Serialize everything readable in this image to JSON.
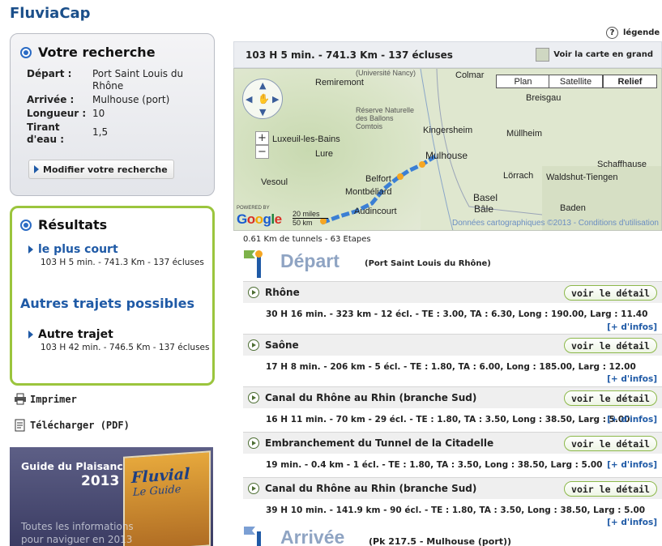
{
  "brand": "FluviaCap",
  "search": {
    "title": "Votre recherche",
    "rows": [
      {
        "label": "Départ :",
        "value": "Port Saint Louis du Rhône"
      },
      {
        "label": "Arrivée :",
        "value": "Mulhouse (port)"
      },
      {
        "label": "Longueur :",
        "value": "10"
      },
      {
        "label": "Tirant d'eau :",
        "value": "1,5"
      }
    ],
    "modify_label": "Modifier votre recherche"
  },
  "results": {
    "title": "Résultats",
    "shortest": {
      "label": "le plus court",
      "summary": "103 H 5 min. - 741.3 Km - 137 écluses"
    },
    "others_title": "Autres trajets possibles",
    "other": {
      "label": "Autre trajet",
      "summary": "103 H 42 min. - 746.5 Km - 137 écluses"
    }
  },
  "actions": {
    "print": "Imprimer",
    "download": "Télécharger (PDF)"
  },
  "promo": {
    "title": "Guide du Plaisancier",
    "year": "2013",
    "book_title": "Fluvial",
    "book_sub": "Le Guide",
    "text": "Toutes les informations pour naviguer en 2013"
  },
  "legend": "légende",
  "route": {
    "summary": "103 H 5 min. - 741.3 Km - 137 écluses",
    "big_map": "Voir la carte en grand",
    "tunnels": "0.61 Km de tunnels - 63 Etapes"
  },
  "map": {
    "types": [
      "Plan",
      "Satellite",
      "Relief"
    ],
    "active_type": "Relief",
    "cities": {
      "colmar": "Colmar",
      "remiremont": "Remiremont",
      "breisgau": "Breisgau",
      "kingersheim": "Kingersheim",
      "mulhouse": "Mulhouse",
      "mullheim": "Müllheim",
      "luxeuil": "Luxeuil-les-Bains",
      "lure": "Lure",
      "vesoul": "Vesoul",
      "belfort": "Belfort",
      "montbeliard": "Montbéliard",
      "lorrach": "Lörrach",
      "waldshut": "Waldshut-Tiengen",
      "schaffhause": "Schaffhause",
      "basel": "Basel",
      "bale": "Bâle",
      "baden": "Baden",
      "audincourt": "Audincourt",
      "reserve": "Réserve Naturelle des Ballons Comtois",
      "nancy": "(Université Nancy)"
    },
    "google": "Google",
    "powered": "POWERED BY",
    "scale_mi": "20 miles",
    "scale_km": "50 km",
    "credit": "Données cartographiques ©2013 - Conditions d'utilisation"
  },
  "depart": {
    "title": "Départ",
    "sub": "(Port Saint Louis du Rhône)"
  },
  "detail_label": "voir le détail",
  "more_label": "[+ d'infos]",
  "segments": [
    {
      "name": "Rhône",
      "info": "30 H 16 min. - 323 km - 12 écl. - TE : 3.00, TA : 6.30, Long : 190.00, Larg : 11.40"
    },
    {
      "name": "Saône",
      "info": "17 H 8 min. - 206 km - 5 écl. - TE : 1.80, TA : 6.00, Long : 185.00, Larg : 12.00"
    },
    {
      "name": "Canal du Rhône au Rhin (branche Sud)",
      "info": "16 H 11 min. - 70 km - 29 écl. - TE : 1.80, TA : 3.50, Long : 38.50, Larg : 5.00"
    },
    {
      "name": "Embranchement du Tunnel de la Citadelle",
      "info": "19 min. - 0.4 km - 1 écl. - TE : 1.80, TA : 3.50, Long : 38.50, Larg : 5.00"
    },
    {
      "name": "Canal du Rhône au Rhin (branche Sud)",
      "info": "39 H 10 min. - 141.9 km - 90 écl. - TE : 1.80, TA : 3.50, Long : 38.50, Larg : 5.00"
    }
  ],
  "arrivee": {
    "title": "Arrivée",
    "sub": "(Pk 217.5 - Mulhouse (port))"
  },
  "colors": {
    "brand": "#1b4f8a",
    "accent_green": "#9bc53d",
    "link_blue": "#1f5aa6",
    "route": "#3b7fd4"
  }
}
